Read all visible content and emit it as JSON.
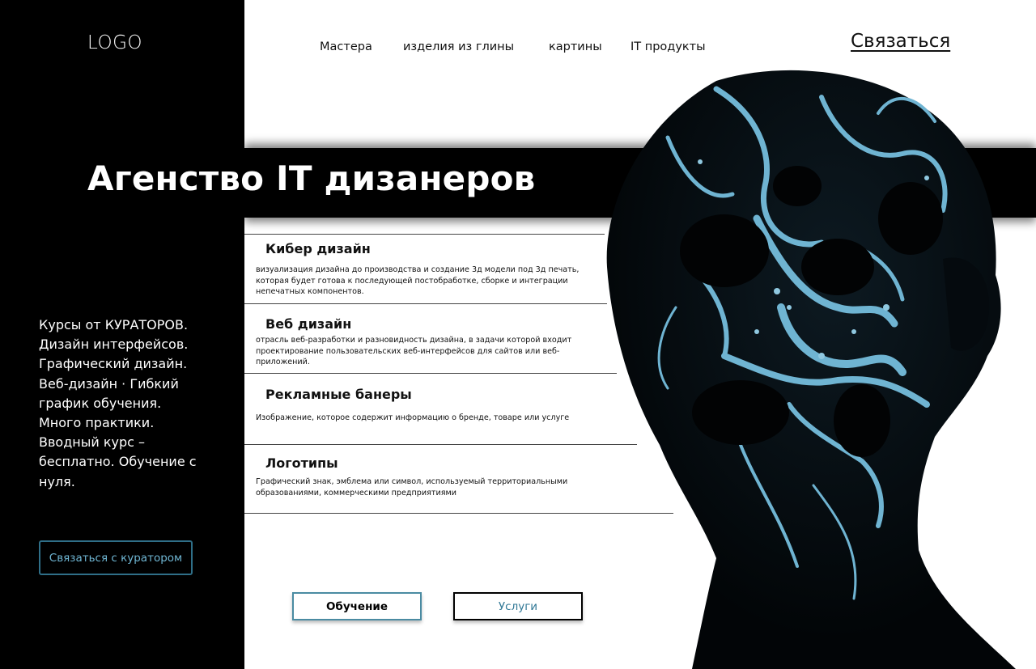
{
  "sidebar": {
    "logo": "LOGO",
    "courses_text": "Курсы от КУРАТОРОВ. Дизайн интерфейсов. Графический дизайн. Веб-дизайн · Гибкий график обучения. Много практики. Вводный курс – бесплатно. Обучение с нуля.",
    "curator_button": "Связаться с куратором"
  },
  "nav": {
    "items": [
      "Мастера",
      "изделия из глины",
      "картины",
      "IT продукты"
    ],
    "contact": "Связаться"
  },
  "hero": {
    "title": "Агенство IT дизанеров"
  },
  "services": [
    {
      "title": "Кибер дизайн",
      "description": "визуализация дизайна до производства и создание 3д модели под 3д печать, которая будет готова к последующей постобработке, сборке и интеграции непечатных компонентов."
    },
    {
      "title": "Веб дизайн",
      "description": "отрасль веб-разработки и разновидность дизайна, в задачи которой входит проектирование пользовательских веб-интерфейсов для сайтов или веб-приложений."
    },
    {
      "title": "Рекламные банеры",
      "description": "Изображение, которое содержит информацию о бренде, товаре или услуге"
    },
    {
      "title": "Логотипы",
      "description": "Графический знак, эмблема или символ, используемый территориальными образованиями, коммерческими предприятиями"
    }
  ],
  "buttons": {
    "learn": "Обучение",
    "services": "Услуги"
  },
  "colors": {
    "sidebar_bg": "#000000",
    "accent_blue": "#2f7795",
    "button_border": "#4a8ba2"
  },
  "icons": {
    "hero_image": "abstract-head-sculpture"
  }
}
